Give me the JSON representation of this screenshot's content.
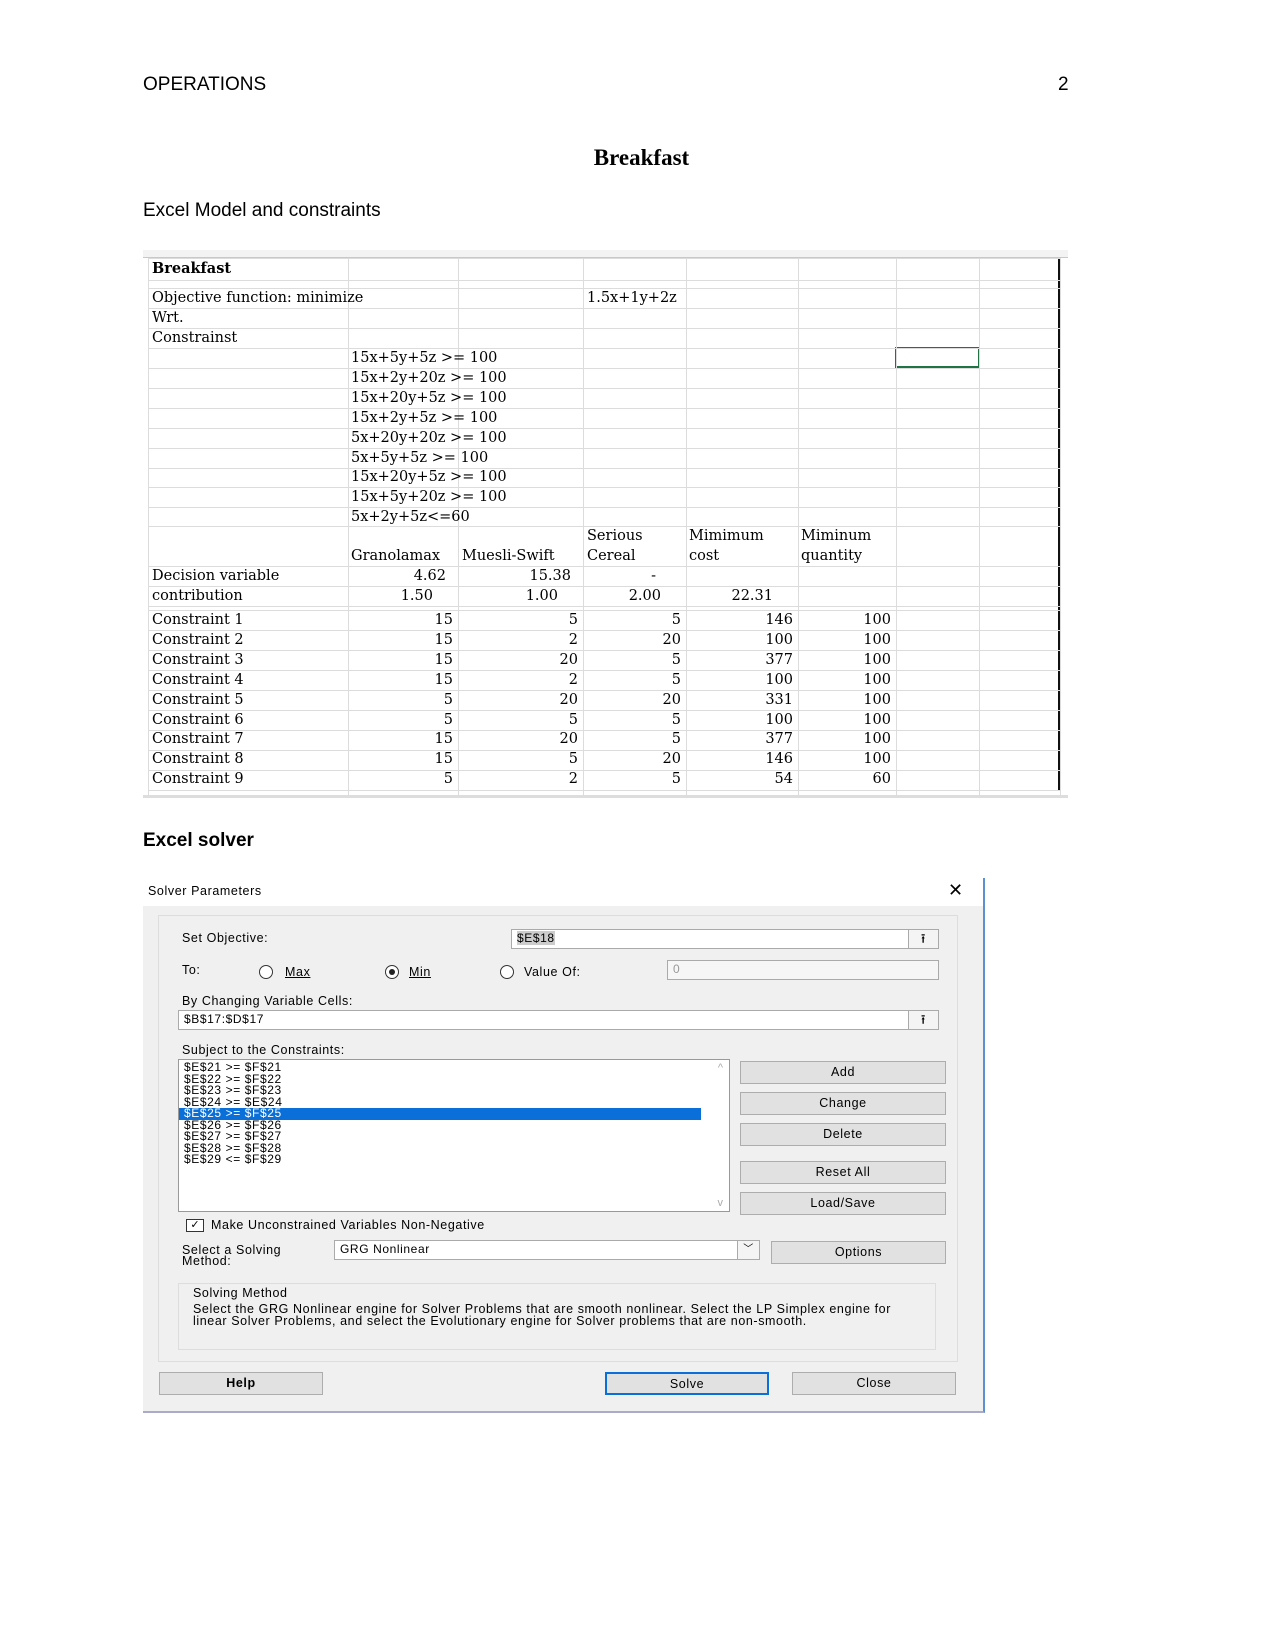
{
  "page": {
    "header_left": "OPERATIONS",
    "page_number": "2",
    "title": "Breakfast",
    "section1": "Excel Model and constraints",
    "section2": "Excel solver"
  },
  "sheet": {
    "title": "Breakfast",
    "objective_label": "Objective function: minimize",
    "objective": "1.5x+1y+2z",
    "wrt": "Wrt.",
    "constraints_label": "Constrainst",
    "constraint_equations": [
      "15x+5y+5z >= 100",
      "15x+2y+20z >= 100",
      "15x+20y+5z >= 100",
      "15x+2y+5z >= 100",
      "5x+20y+20z >= 100",
      "5x+5y+5z >= 100",
      "15x+20y+5z >= 100",
      "15x+5y+20z >= 100",
      "5x+2y+5z<=60"
    ],
    "col_headers": [
      "Granolamax",
      "Muesli-Swift",
      "Serious",
      "Cereal",
      "Mimimum",
      "cost",
      "Miminum",
      "quantity"
    ],
    "decision": {
      "label": "Decision variable",
      "values": [
        "4.62",
        "15.38",
        "-"
      ]
    },
    "contribution": {
      "label": "contribution",
      "values": [
        "1.50",
        "1.00",
        "2.00",
        "22.31"
      ]
    },
    "rows": [
      {
        "label": "Constraint 1",
        "v": [
          "15",
          "5",
          "5",
          "146",
          "100"
        ]
      },
      {
        "label": "Constraint 2",
        "v": [
          "15",
          "2",
          "20",
          "100",
          "100"
        ]
      },
      {
        "label": "Constraint 3",
        "v": [
          "15",
          "20",
          "5",
          "377",
          "100"
        ]
      },
      {
        "label": "Constraint 4",
        "v": [
          "15",
          "2",
          "5",
          "100",
          "100"
        ]
      },
      {
        "label": "Constraint 5",
        "v": [
          "5",
          "20",
          "20",
          "331",
          "100"
        ]
      },
      {
        "label": "Constraint 6",
        "v": [
          "5",
          "5",
          "5",
          "100",
          "100"
        ]
      },
      {
        "label": "Constraint 7",
        "v": [
          "15",
          "20",
          "5",
          "377",
          "100"
        ]
      },
      {
        "label": "Constraint 8",
        "v": [
          "15",
          "5",
          "20",
          "146",
          "100"
        ]
      },
      {
        "label": "Constraint 9",
        "v": [
          "5",
          "2",
          "5",
          "54",
          "60"
        ]
      }
    ]
  },
  "solver": {
    "title": "Solver Parameters",
    "set_objective_label": "Set Objective:",
    "set_objective": "$E$18",
    "to_label": "To:",
    "max": "Max",
    "min": "Min",
    "value_of": "Value Of:",
    "value_of_value": "0",
    "selected": "Min",
    "changing_label": "By Changing Variable Cells:",
    "changing": "$B$17:$D$17",
    "constraints_label": "Subject to the Constraints:",
    "constraints": [
      "$E$21 >= $F$21",
      "$E$22 >= $F$22",
      "$E$23 >= $F$23",
      "$E$24 >= $E$24",
      "$E$25 >= $F$25",
      "$E$26 >= $F$26",
      "$E$27 >= $F$27",
      "$E$28 >= $F$28",
      "$E$29 <= $F$29"
    ],
    "selected_constraint": 4,
    "buttons": {
      "add": "Add",
      "change": "Change",
      "delete": "Delete",
      "reset": "Reset All",
      "loadsave": "Load/Save",
      "options": "Options",
      "help": "Help",
      "solve": "Solve",
      "close": "Close"
    },
    "nonneg_label": "Make Unconstrained Variables Non-Negative",
    "nonneg_checked": true,
    "method_label_1": "Select a Solving",
    "method_label_2": "Method:",
    "method": "GRG Nonlinear",
    "method_box_title": "Solving Method",
    "method_desc": "Select the GRG Nonlinear engine for Solver Problems that are smooth nonlinear. Select the LP Simplex engine for linear Solver Problems, and select the Evolutionary engine for Solver problems that are non-smooth.",
    "accent": "#0a6fd8"
  }
}
